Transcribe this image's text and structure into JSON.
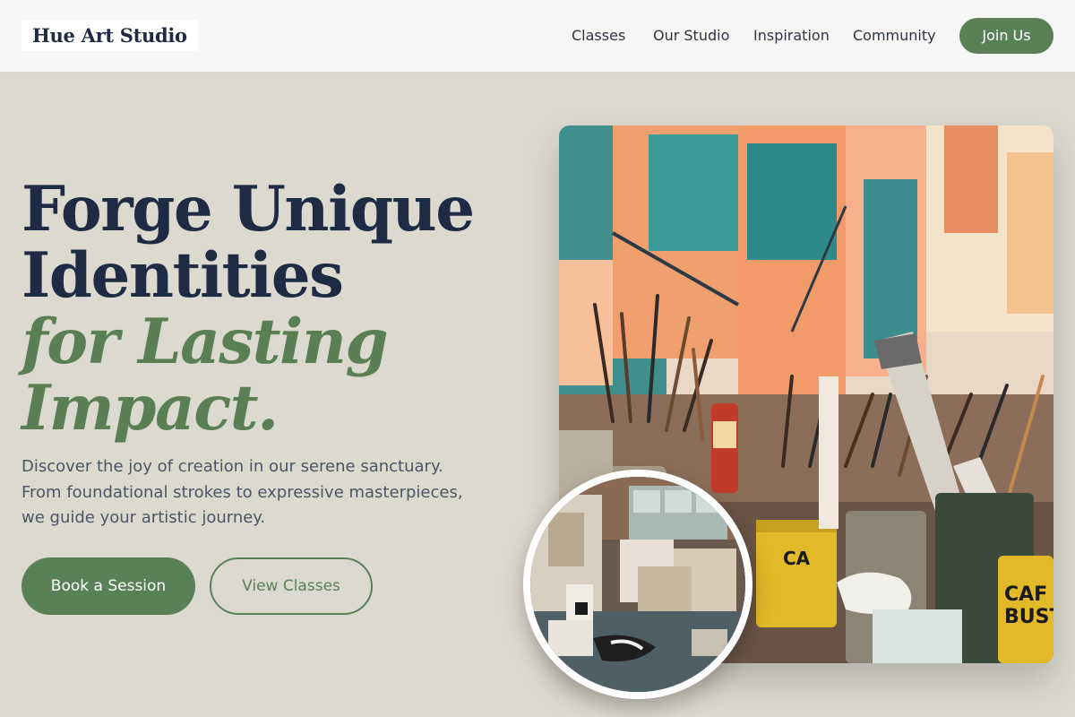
{
  "header": {
    "logo": "Hue Art Studio",
    "nav": [
      "Classes",
      "Our Studio",
      "Inspiration",
      "Community"
    ],
    "cta": "Join Us"
  },
  "hero": {
    "headline_line1": "Forge Unique",
    "headline_line2": "Identities",
    "headline_accent1": "for Lasting",
    "headline_accent2": "Impact.",
    "subtitle": "Discover the joy of creation in our serene sanctuary. From foundational strokes to expressive masterpieces, we guide your artistic journey.",
    "primary_button": "Book a Session",
    "secondary_button": "View Classes"
  },
  "colors": {
    "background": "#dcd9ce",
    "accent_green": "#5a8058",
    "navy": "#1f2a44"
  },
  "images": {
    "main": "paint-brushes-in-jars-photo",
    "inset": "cluttered-art-studio-photo"
  }
}
